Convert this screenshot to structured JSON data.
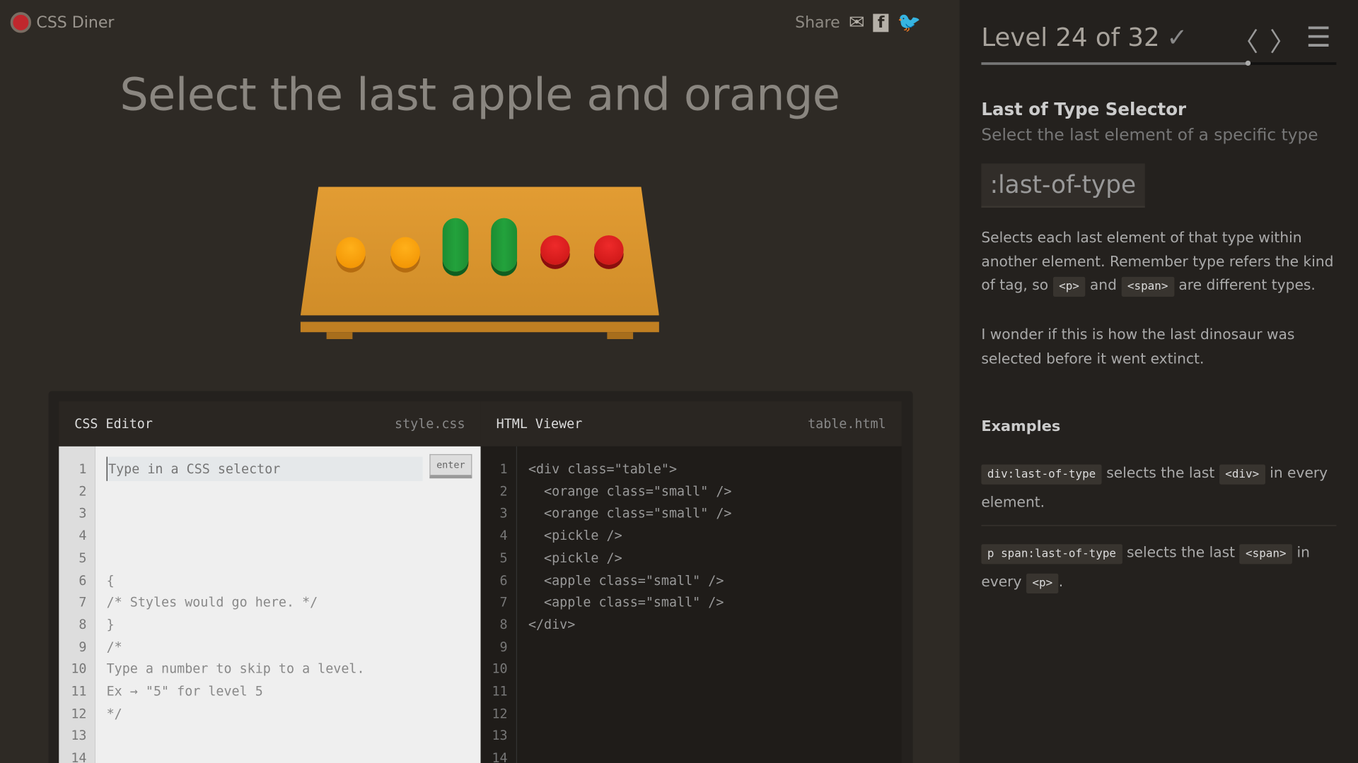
{
  "app": {
    "name": "CSS Diner"
  },
  "share": {
    "label": "Share",
    "icons": [
      "email-icon",
      "facebook-icon",
      "twitter-icon"
    ]
  },
  "order": "Select the last apple and orange",
  "table_items": [
    "orange",
    "orange",
    "pickle",
    "pickle",
    "apple",
    "apple"
  ],
  "editor": {
    "css_title": "CSS Editor",
    "css_file": "style.css",
    "html_title": "HTML Viewer",
    "html_file": "table.html",
    "placeholder": "Type in a CSS selector",
    "enter": "enter",
    "css_lines": [
      "",
      "{",
      "/* Styles would go here. */",
      "}",
      "",
      "/*",
      "Type a number to skip to a level.",
      "Ex → \"5\" for level 5",
      "*/"
    ],
    "html_lines": [
      "<div class=\"table\">",
      "  <orange class=\"small\" />",
      "  <orange class=\"small\" />",
      "  <pickle />",
      "  <pickle />",
      "  <apple class=\"small\" />",
      "  <apple class=\"small\" />",
      "</div>"
    ],
    "line_numbers": [
      "1",
      "2",
      "3",
      "4",
      "5",
      "6",
      "7",
      "8",
      "9",
      "10",
      "11",
      "12",
      "13",
      "14"
    ]
  },
  "level": {
    "label": "Level 24 of 32",
    "check": "✓",
    "current": 24,
    "total": 32,
    "progress": 0.75
  },
  "lesson": {
    "title": "Last of Type Selector",
    "subtitle": "Select the last element of a specific type",
    "syntax": ":last-of-type",
    "desc1": "Selects each last element of that type within another element. Remember type refers the kind of tag, so",
    "code_p": "<p>",
    "and": "and",
    "code_span": "<span>",
    "desc2": "are different types.",
    "note": "I wonder if this is how the last dinosaur was selected before it went extinct.",
    "examples_title": "Examples",
    "ex1_code": "div:last-of-type",
    "ex1_text": "selects the last",
    "ex1_code2": "<div>",
    "ex1_text2": "in every element.",
    "ex2_code": "p span:last-of-type",
    "ex2_text": "selects the last",
    "ex2_code2": "<span>",
    "ex2_text2": "in every",
    "ex2_code3": "<p>",
    "ex2_end": "."
  }
}
